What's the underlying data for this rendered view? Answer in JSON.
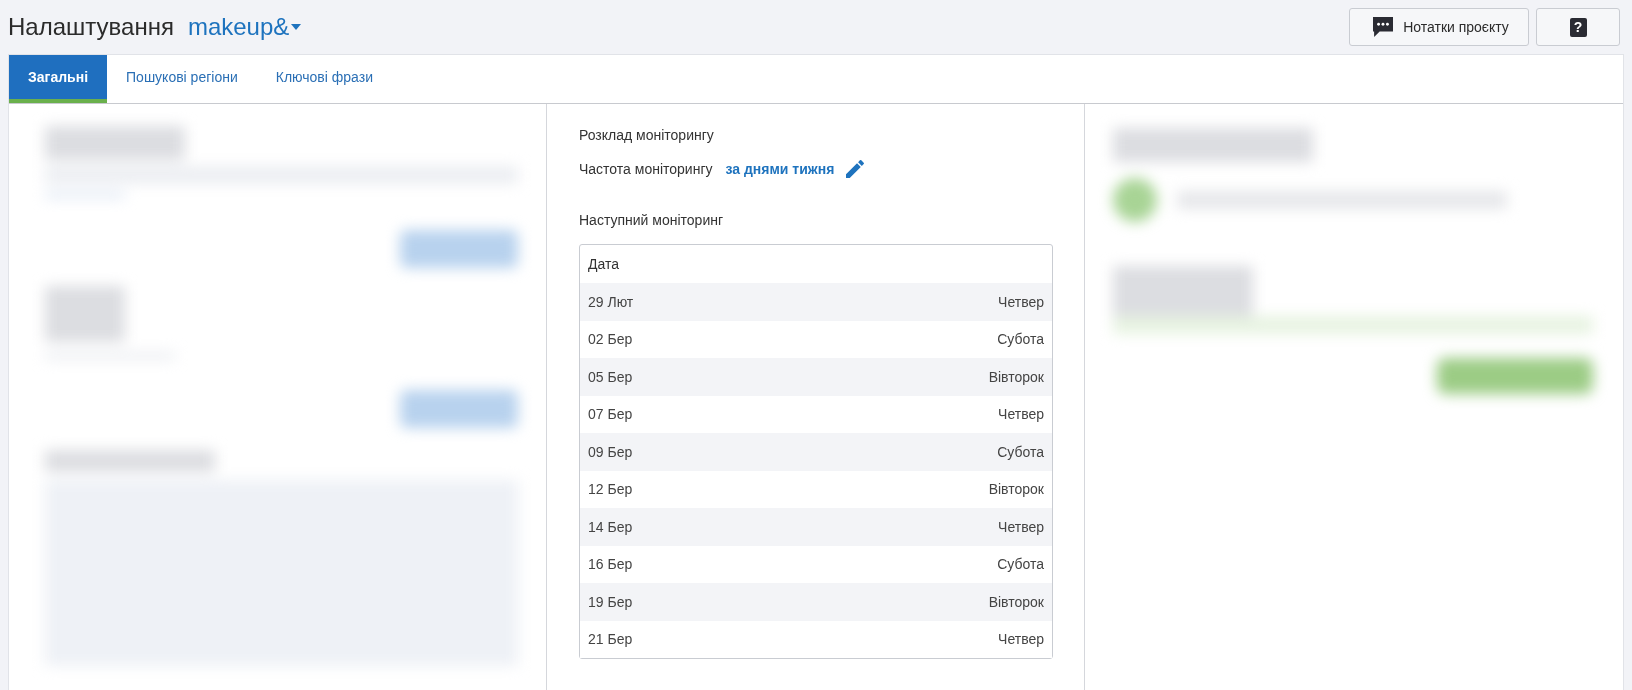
{
  "header": {
    "title": "Налаштування",
    "project": "makeup&",
    "buttons": [
      {
        "kind": "notes",
        "label": "Нотатки проєкту"
      },
      {
        "kind": "help",
        "label": "?"
      }
    ]
  },
  "tabs": [
    {
      "label": "Загальні",
      "selected": true
    },
    {
      "label": "Пошукові регіони",
      "selected": false
    },
    {
      "label": "Ключові фрази",
      "selected": false
    }
  ],
  "schedule": {
    "title": "Розклад моніторингу",
    "frequency_label": "Частота моніторингу",
    "frequency_value": "за днями тижня",
    "next_title": "Наступний моніторинг",
    "table": {
      "columns": [
        "Дата"
      ],
      "rows": [
        {
          "date": "29 Лют",
          "weekday": "Четвер"
        },
        {
          "date": "02 Бер",
          "weekday": "Субота"
        },
        {
          "date": "05 Бер",
          "weekday": "Вівторок"
        },
        {
          "date": "07 Бер",
          "weekday": "Четвер"
        },
        {
          "date": "09 Бер",
          "weekday": "Субота"
        },
        {
          "date": "12 Бер",
          "weekday": "Вівторок"
        },
        {
          "date": "14 Бер",
          "weekday": "Четвер"
        },
        {
          "date": "16 Бер",
          "weekday": "Субота"
        },
        {
          "date": "19 Бер",
          "weekday": "Вівторок"
        },
        {
          "date": "21 Бер",
          "weekday": "Четвер"
        }
      ]
    }
  }
}
